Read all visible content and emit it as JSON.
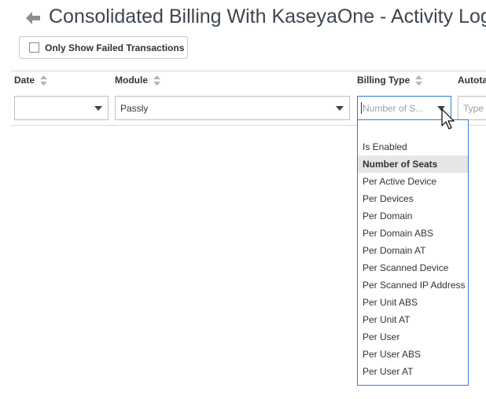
{
  "header": {
    "title": "Consolidated Billing With KaseyaOne - Activity Log",
    "back_icon": "arrow-left-icon"
  },
  "toolbar": {
    "failed_only_label": "Only Show Failed Transactions",
    "failed_only_checked": false
  },
  "grid": {
    "columns": [
      {
        "title": "Date",
        "filter_value": ""
      },
      {
        "title": "Module",
        "filter_value": "Passly"
      },
      {
        "title": "Billing Type",
        "filter_placeholder": "Number of S..."
      },
      {
        "title": "Autota",
        "filter_placeholder": "Type"
      }
    ]
  },
  "billing_type_dropdown": {
    "selected": "Number of Seats",
    "options": [
      "",
      "Is Enabled",
      "Number of Seats",
      "Per Active Device",
      "Per Devices",
      "Per Domain",
      "Per Domain ABS",
      "Per Domain AT",
      "Per Scanned Device",
      "Per Scanned IP Address",
      "Per Unit ABS",
      "Per Unit AT",
      "Per User",
      "Per User ABS",
      "Per User AT"
    ]
  },
  "colors": {
    "accent": "#2f7bd8",
    "title": "#3d4650",
    "selected_bg": "#e6e6e6"
  }
}
